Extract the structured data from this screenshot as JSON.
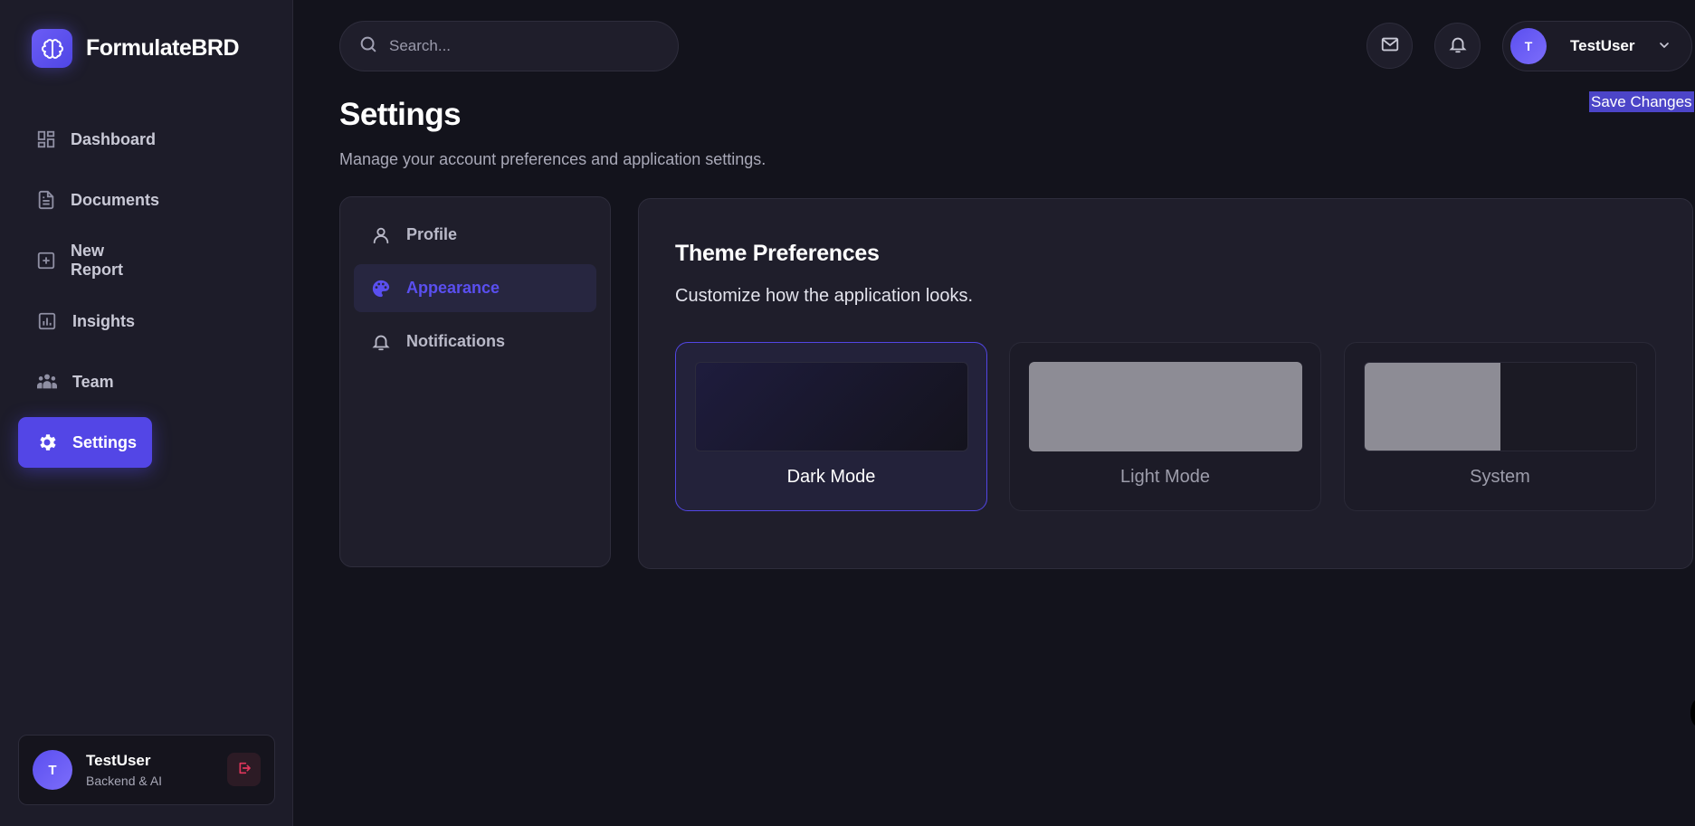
{
  "brand": {
    "name": "FormulateBRD"
  },
  "sidebar": {
    "items": [
      {
        "label": "Dashboard",
        "icon": "dashboard-icon"
      },
      {
        "label": "Documents",
        "icon": "document-icon"
      },
      {
        "label": "New Report",
        "icon": "plus-square-icon"
      },
      {
        "label": "Insights",
        "icon": "bar-chart-icon"
      },
      {
        "label": "Team",
        "icon": "team-icon"
      },
      {
        "label": "Settings",
        "icon": "gear-icon",
        "active": true
      }
    ],
    "user": {
      "initial": "T",
      "name": "TestUser",
      "role": "Backend & AI"
    }
  },
  "header": {
    "search_placeholder": "Search...",
    "user": {
      "initial": "T",
      "name": "TestUser"
    }
  },
  "page": {
    "title": "Settings",
    "subtitle": "Manage your account preferences and application settings.",
    "save_label": "Save Changes"
  },
  "settings_nav": [
    {
      "label": "Profile",
      "icon": "user-icon"
    },
    {
      "label": "Appearance",
      "icon": "palette-icon",
      "active": true
    },
    {
      "label": "Notifications",
      "icon": "bell-icon"
    }
  ],
  "theme": {
    "title": "Theme Preferences",
    "description": "Customize how the application looks.",
    "options": [
      {
        "label": "Dark Mode",
        "selected": true
      },
      {
        "label": "Light Mode",
        "selected": false
      },
      {
        "label": "System",
        "selected": false
      }
    ]
  },
  "colors": {
    "accent": "#5346e6",
    "background": "#13131c",
    "sidebar": "#1d1c29",
    "card": "#1f1e2b",
    "logout": "#e0365c"
  }
}
